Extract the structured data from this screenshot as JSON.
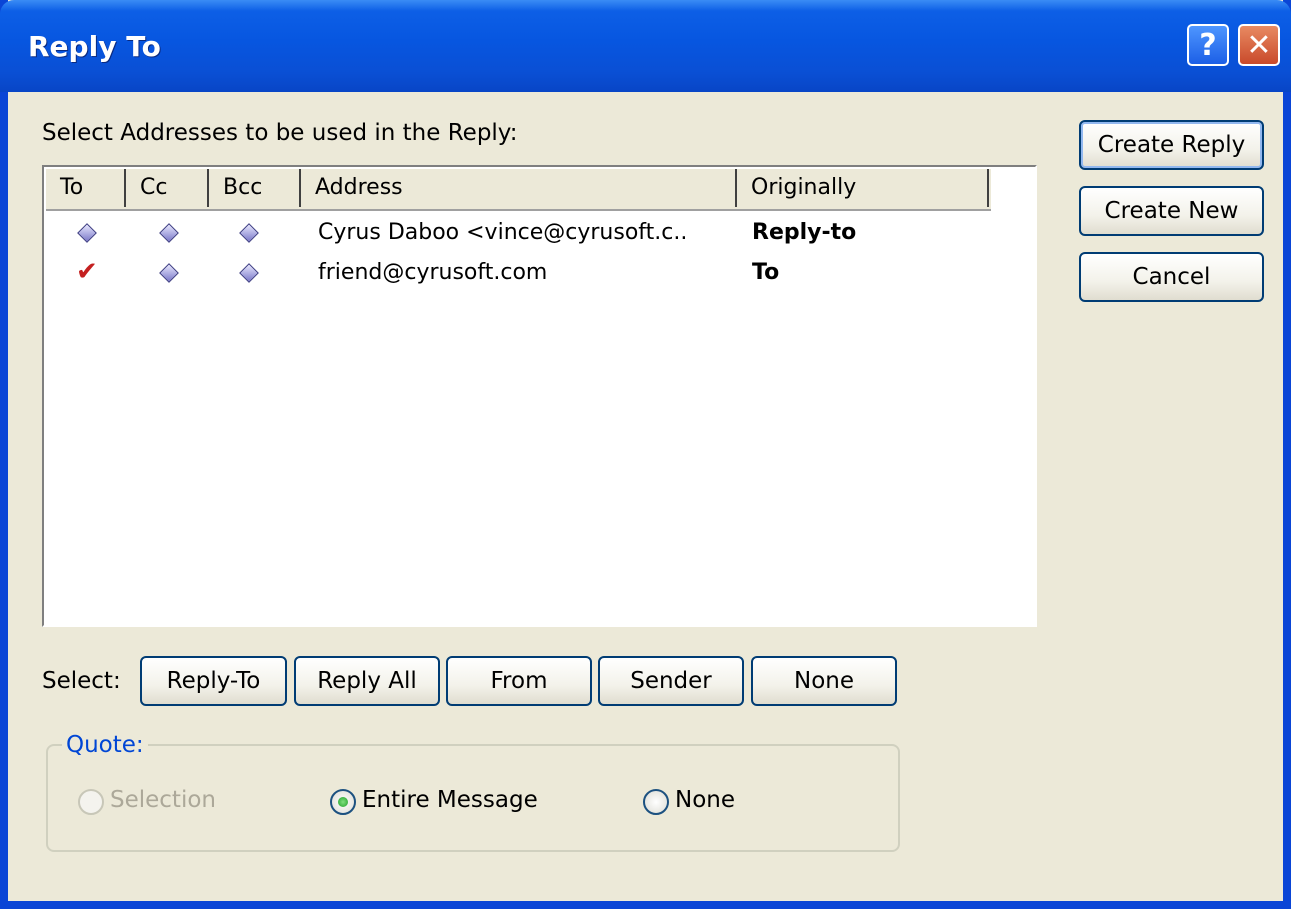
{
  "window": {
    "title": "Reply To"
  },
  "titlebar": {
    "help_symbol": "?",
    "close_symbol": "✕"
  },
  "prompt": "Select Addresses to be used in the Reply:",
  "columns": [
    "To",
    "Cc",
    "Bcc",
    "Address",
    "Originally"
  ],
  "rows": [
    {
      "to": "diamond",
      "cc": "diamond",
      "bcc": "diamond",
      "address": "Cyrus Daboo <vince@cyrusoft.c..",
      "originally": "Reply-to"
    },
    {
      "to": "check",
      "cc": "diamond",
      "bcc": "diamond",
      "address": "friend@cyrusoft.com",
      "originally": "To"
    }
  ],
  "actions": {
    "create_reply": "Create Reply",
    "create_new": "Create New",
    "cancel": "Cancel"
  },
  "select": {
    "label": "Select:",
    "buttons": [
      "Reply-To",
      "Reply All",
      "From",
      "Sender",
      "None"
    ]
  },
  "quote": {
    "title": "Quote:",
    "options": [
      {
        "label": "Selection",
        "checked": false,
        "enabled": false
      },
      {
        "label": "Entire Message",
        "checked": true,
        "enabled": true
      },
      {
        "label": "None",
        "checked": false,
        "enabled": true
      }
    ]
  },
  "icons": {
    "check": "✔"
  }
}
